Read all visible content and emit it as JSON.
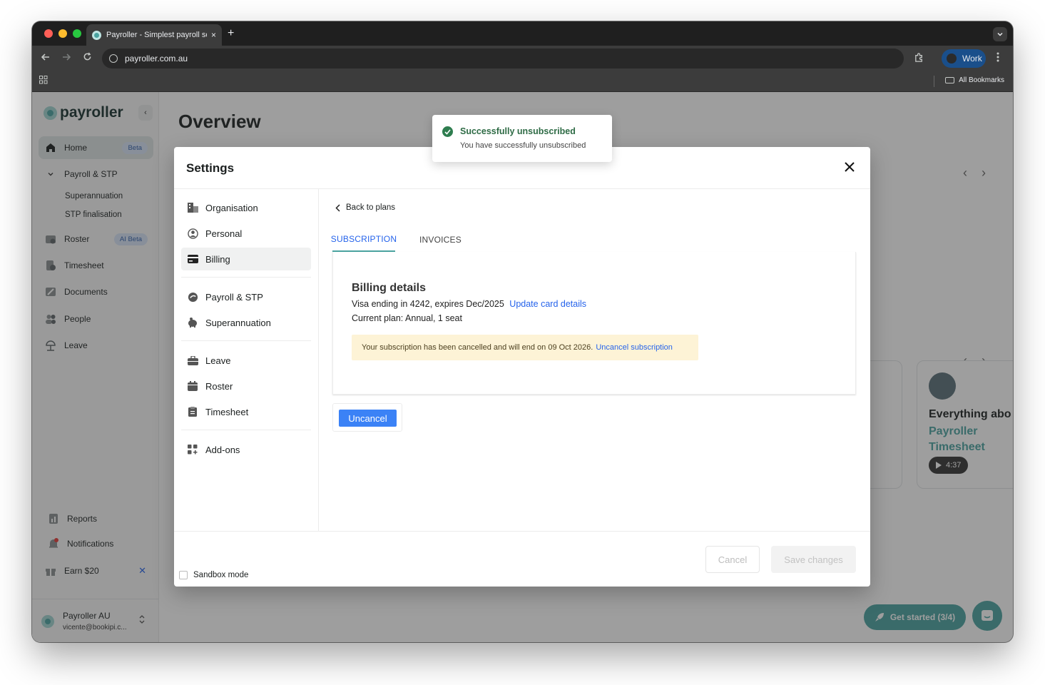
{
  "browser": {
    "tab_title": "Payroller - Simplest payroll so",
    "tab_close": "×",
    "new_tab": "+",
    "url": "payroller.com.au",
    "profile": "Work",
    "all_bookmarks": "All Bookmarks"
  },
  "sidebar": {
    "brand": "payroller",
    "collapse": "‹",
    "items": [
      {
        "label": "Home",
        "badge": "Beta",
        "icon": "home-icon"
      },
      {
        "label": "Payroll & STP",
        "icon": "chevron-down-icon"
      },
      {
        "label": "Roster",
        "badge": "AI Beta",
        "icon": "roster-icon"
      },
      {
        "label": "Timesheet",
        "icon": "timesheet-icon"
      },
      {
        "label": "Documents",
        "icon": "documents-icon"
      },
      {
        "label": "People",
        "icon": "people-icon"
      },
      {
        "label": "Leave",
        "icon": "leave-icon"
      }
    ],
    "sub_items": [
      "Superannuation",
      "STP finalisation"
    ],
    "bottom_items": [
      {
        "label": "Reports",
        "icon": "reports-icon"
      },
      {
        "label": "Notifications",
        "icon": "bell-icon"
      },
      {
        "label": "Earn $20",
        "icon": "gift-icon",
        "close": "✕"
      }
    ],
    "account": {
      "name": "Payroller AU",
      "email": "vicente@bookipi.c..."
    }
  },
  "main": {
    "title": "Overview",
    "video_card": {
      "title": "Everything abo",
      "subtitle_1": "Payroller",
      "subtitle_2": "Timesheet",
      "duration": "4:37"
    },
    "get_started": "Get started (3/4)"
  },
  "toast": {
    "title": "Successfully unsubscribed",
    "message": "You have successfully unsubscribed"
  },
  "modal": {
    "title": "Settings",
    "close": "×",
    "nav": {
      "group1": [
        {
          "label": "Organisation",
          "icon": "building-icon"
        },
        {
          "label": "Personal",
          "icon": "user-circle-icon"
        },
        {
          "label": "Billing",
          "icon": "credit-card-icon",
          "active": true
        }
      ],
      "group2": [
        {
          "label": "Payroll & STP",
          "icon": "payroll-icon"
        },
        {
          "label": "Superannuation",
          "icon": "piggy-bank-icon"
        }
      ],
      "group3": [
        {
          "label": "Leave",
          "icon": "suitcase-icon"
        },
        {
          "label": "Roster",
          "icon": "calendar-icon"
        },
        {
          "label": "Timesheet",
          "icon": "clipboard-icon"
        }
      ],
      "group4": [
        {
          "label": "Add-ons",
          "icon": "grid-plus-icon"
        }
      ]
    },
    "back": "Back to plans",
    "tabs": [
      "SUBSCRIPTION",
      "INVOICES"
    ],
    "billing": {
      "title": "Billing details",
      "card_info": "Visa ending in 4242, expires Dec/2025",
      "update_link": "Update card details",
      "plan": "Current plan: Annual, 1 seat",
      "notice": "Your subscription has been cancelled and will end on 09 Oct 2026.",
      "notice_link": "Uncancel subscription"
    },
    "uncancel_button": "Uncancel",
    "sandbox": "Sandbox mode",
    "cancel_button": "Cancel",
    "save_button": "Save changes"
  },
  "colors": {
    "brand": "#4aa3a0",
    "link": "#2563eb",
    "primary_button": "#3b82f6",
    "success": "#2e7d4f",
    "notice_bg": "#fdf3d6"
  }
}
